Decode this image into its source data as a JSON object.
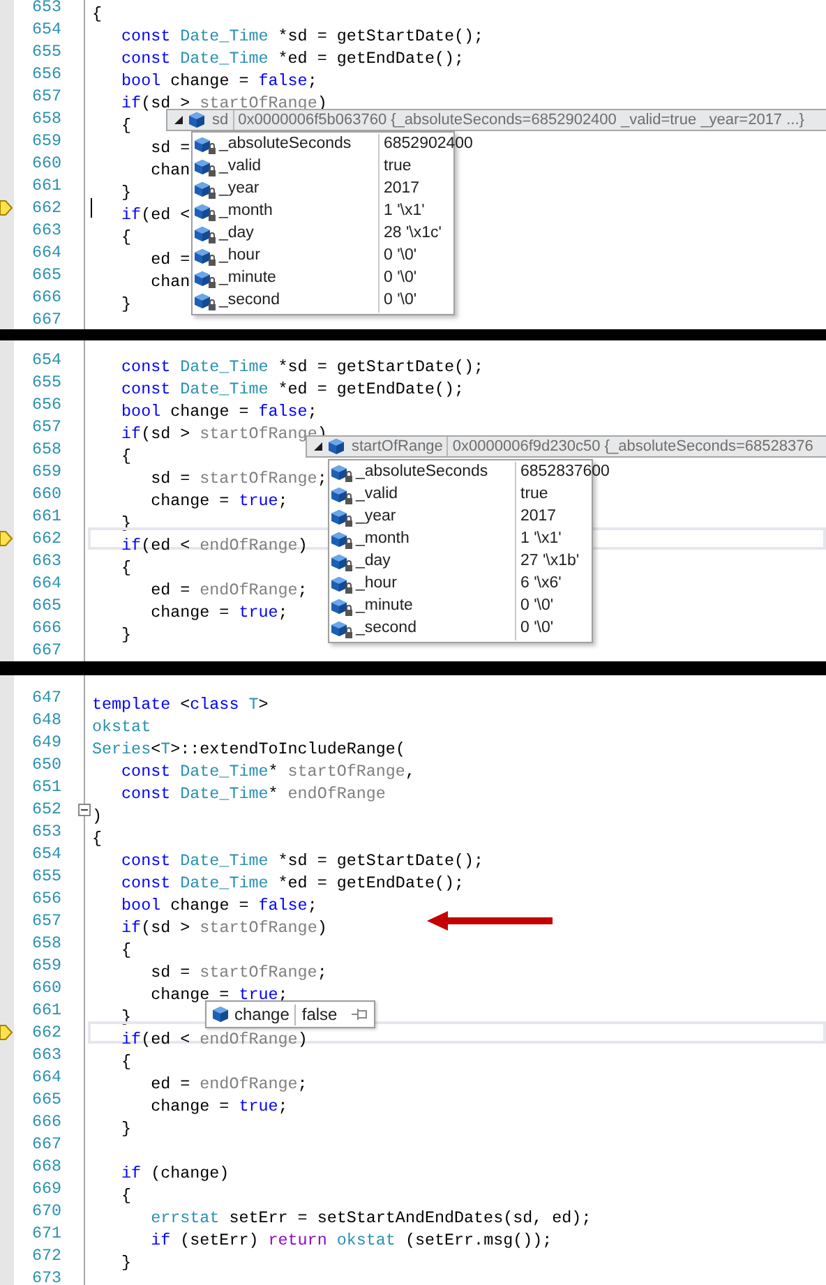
{
  "panels": [
    {
      "caret": true,
      "line_frame": false,
      "arrow": false,
      "lines": [
        {
          "number": "653",
          "current": false,
          "code": [
            {
              "kind": "plain",
              "text": "{"
            }
          ]
        },
        {
          "number": "654",
          "current": false,
          "code": [
            {
              "kind": "keyword",
              "text": "   const "
            },
            {
              "kind": "type",
              "text": "Date_Time"
            },
            {
              "kind": "plain",
              "text": " *sd = getStartDate();"
            }
          ]
        },
        {
          "number": "655",
          "current": false,
          "code": [
            {
              "kind": "keyword",
              "text": "   const "
            },
            {
              "kind": "type",
              "text": "Date_Time"
            },
            {
              "kind": "plain",
              "text": " *ed = getEndDate();"
            }
          ]
        },
        {
          "number": "656",
          "current": false,
          "code": [
            {
              "kind": "keyword",
              "text": "   bool"
            },
            {
              "kind": "plain",
              "text": " change = "
            },
            {
              "kind": "keyword",
              "text": "false"
            },
            {
              "kind": "plain",
              "text": ";"
            }
          ]
        },
        {
          "number": "657",
          "current": false,
          "code": [
            {
              "kind": "keyword",
              "text": "   if"
            },
            {
              "kind": "plain",
              "text": "(sd > "
            },
            {
              "kind": "parameter",
              "text": "startOfRange"
            },
            {
              "kind": "plain",
              "text": ")"
            }
          ]
        },
        {
          "number": "658",
          "current": false,
          "code": [
            {
              "kind": "plain",
              "text": "   {"
            }
          ]
        },
        {
          "number": "659",
          "current": false,
          "code": [
            {
              "kind": "plain",
              "text": "      sd ="
            }
          ]
        },
        {
          "number": "660",
          "current": false,
          "code": [
            {
              "kind": "plain",
              "text": "      chan"
            }
          ]
        },
        {
          "number": "661",
          "current": false,
          "code": [
            {
              "kind": "plain",
              "text": "   }"
            }
          ]
        },
        {
          "number": "662",
          "current": true,
          "code": [
            {
              "kind": "keyword",
              "text": "   if"
            },
            {
              "kind": "plain",
              "text": "(ed <"
            }
          ]
        },
        {
          "number": "663",
          "current": false,
          "code": [
            {
              "kind": "plain",
              "text": "   {"
            }
          ]
        },
        {
          "number": "664",
          "current": false,
          "code": [
            {
              "kind": "plain",
              "text": "      ed ="
            }
          ]
        },
        {
          "number": "665",
          "current": false,
          "code": [
            {
              "kind": "plain",
              "text": "      chan"
            }
          ]
        },
        {
          "number": "666",
          "current": false,
          "code": [
            {
              "kind": "plain",
              "text": "   }"
            }
          ]
        },
        {
          "number": "667",
          "current": false
        }
      ],
      "datatip": {
        "kind": "expandable",
        "name": "sd",
        "summary": "0x0000006f5b063760 {_absoluteSeconds=6852902400 _valid=true _year=2017 ...}",
        "members": [
          {
            "name": "_absoluteSeconds",
            "value": "6852902400"
          },
          {
            "name": "_valid",
            "value": "true"
          },
          {
            "name": "_year",
            "value": "2017"
          },
          {
            "name": "_month",
            "value": "1 '\\x1'"
          },
          {
            "name": "_day",
            "value": "28 '\\x1c'"
          },
          {
            "name": "_hour",
            "value": "0 '\\0'"
          },
          {
            "name": "_minute",
            "value": "0 '\\0'"
          },
          {
            "name": "_second",
            "value": "0 '\\0'"
          }
        ]
      }
    },
    {
      "caret": false,
      "line_frame": true,
      "arrow": false,
      "lines": [
        {
          "number": "654",
          "current": false,
          "code": [
            {
              "kind": "keyword",
              "text": "   const "
            },
            {
              "kind": "type",
              "text": "Date_Time"
            },
            {
              "kind": "plain",
              "text": " *sd = getStartDate();"
            }
          ]
        },
        {
          "number": "655",
          "current": false,
          "code": [
            {
              "kind": "keyword",
              "text": "   const "
            },
            {
              "kind": "type",
              "text": "Date_Time"
            },
            {
              "kind": "plain",
              "text": " *ed = getEndDate();"
            }
          ]
        },
        {
          "number": "656",
          "current": false,
          "code": [
            {
              "kind": "keyword",
              "text": "   bool"
            },
            {
              "kind": "plain",
              "text": " change = "
            },
            {
              "kind": "keyword",
              "text": "false"
            },
            {
              "kind": "plain",
              "text": ";"
            }
          ]
        },
        {
          "number": "657",
          "current": false,
          "code": [
            {
              "kind": "keyword",
              "text": "   if"
            },
            {
              "kind": "plain",
              "text": "(sd > "
            },
            {
              "kind": "parameter",
              "text": "startOfRange"
            },
            {
              "kind": "plain",
              "text": ")"
            }
          ]
        },
        {
          "number": "658",
          "current": false,
          "code": [
            {
              "kind": "plain",
              "text": "   {"
            }
          ]
        },
        {
          "number": "659",
          "current": false,
          "code": [
            {
              "kind": "plain",
              "text": "      sd = "
            },
            {
              "kind": "parameter",
              "text": "startOfRange"
            },
            {
              "kind": "plain",
              "text": ";"
            }
          ]
        },
        {
          "number": "660",
          "current": false,
          "code": [
            {
              "kind": "plain",
              "text": "      change = "
            },
            {
              "kind": "keyword",
              "text": "true"
            },
            {
              "kind": "plain",
              "text": ";"
            }
          ]
        },
        {
          "number": "661",
          "current": false,
          "code": [
            {
              "kind": "plain",
              "text": "   }"
            }
          ]
        },
        {
          "number": "662",
          "current": true,
          "code": [
            {
              "kind": "keyword",
              "text": "   if"
            },
            {
              "kind": "plain",
              "text": "(ed < "
            },
            {
              "kind": "parameter",
              "text": "endOfRange"
            },
            {
              "kind": "plain",
              "text": ")"
            }
          ]
        },
        {
          "number": "663",
          "current": false,
          "code": [
            {
              "kind": "plain",
              "text": "   {"
            }
          ]
        },
        {
          "number": "664",
          "current": false,
          "code": [
            {
              "kind": "plain",
              "text": "      ed = "
            },
            {
              "kind": "parameter",
              "text": "endOfRange"
            },
            {
              "kind": "plain",
              "text": ";"
            }
          ]
        },
        {
          "number": "665",
          "current": false,
          "code": [
            {
              "kind": "plain",
              "text": "      change = "
            },
            {
              "kind": "keyword",
              "text": "true"
            },
            {
              "kind": "plain",
              "text": ";"
            }
          ]
        },
        {
          "number": "666",
          "current": false,
          "code": [
            {
              "kind": "plain",
              "text": "   }"
            }
          ]
        },
        {
          "number": "667",
          "current": false
        }
      ],
      "datatip": {
        "kind": "expandable",
        "name": "startOfRange",
        "summary": "0x0000006f9d230c50 {_absoluteSeconds=68528376",
        "members": [
          {
            "name": "_absoluteSeconds",
            "value": "6852837600"
          },
          {
            "name": "_valid",
            "value": "true"
          },
          {
            "name": "_year",
            "value": "2017"
          },
          {
            "name": "_month",
            "value": "1 '\\x1'"
          },
          {
            "name": "_day",
            "value": "27 '\\x1b'"
          },
          {
            "name": "_hour",
            "value": "6 '\\x6'"
          },
          {
            "name": "_minute",
            "value": "0 '\\0'"
          },
          {
            "name": "_second",
            "value": "0 '\\0'"
          }
        ]
      }
    },
    {
      "caret": false,
      "line_frame": true,
      "arrow": true,
      "lines": [
        {
          "number": "647",
          "current": false,
          "fold": false,
          "code": [
            {
              "kind": "keyword",
              "text": "template"
            },
            {
              "kind": "plain",
              "text": " <"
            },
            {
              "kind": "keyword",
              "text": "class "
            },
            {
              "kind": "type",
              "text": "T"
            },
            {
              "kind": "plain",
              "text": ">"
            }
          ]
        },
        {
          "number": "648",
          "current": false,
          "fold": false,
          "code": [
            {
              "kind": "type",
              "text": "okstat"
            }
          ]
        },
        {
          "number": "649",
          "current": false,
          "fold": false,
          "code": [
            {
              "kind": "type",
              "text": "Series"
            },
            {
              "kind": "plain",
              "text": "<"
            },
            {
              "kind": "type",
              "text": "T"
            },
            {
              "kind": "plain",
              "text": ">::extendToIncludeRange("
            }
          ]
        },
        {
          "number": "650",
          "current": false,
          "fold": false,
          "code": [
            {
              "kind": "keyword",
              "text": "   const "
            },
            {
              "kind": "type",
              "text": "Date_Time"
            },
            {
              "kind": "plain",
              "text": "* "
            },
            {
              "kind": "parameter",
              "text": "startOfRange"
            },
            {
              "kind": "plain",
              "text": ","
            }
          ]
        },
        {
          "number": "651",
          "current": false,
          "fold": false,
          "code": [
            {
              "kind": "keyword",
              "text": "   const "
            },
            {
              "kind": "type",
              "text": "Date_Time"
            },
            {
              "kind": "plain",
              "text": "* "
            },
            {
              "kind": "parameter",
              "text": "endOfRange"
            }
          ]
        },
        {
          "number": "652",
          "current": false,
          "fold": true,
          "code": [
            {
              "kind": "plain",
              "text": ")"
            }
          ]
        },
        {
          "number": "653",
          "current": false,
          "fold": false,
          "code": [
            {
              "kind": "plain",
              "text": "{"
            }
          ]
        },
        {
          "number": "654",
          "current": false,
          "fold": false,
          "code": [
            {
              "kind": "keyword",
              "text": "   const "
            },
            {
              "kind": "type",
              "text": "Date_Time"
            },
            {
              "kind": "plain",
              "text": " *sd = getStartDate();"
            }
          ]
        },
        {
          "number": "655",
          "current": false,
          "fold": false,
          "code": [
            {
              "kind": "keyword",
              "text": "   const "
            },
            {
              "kind": "type",
              "text": "Date_Time"
            },
            {
              "kind": "plain",
              "text": " *ed = getEndDate();"
            }
          ]
        },
        {
          "number": "656",
          "current": false,
          "fold": false,
          "code": [
            {
              "kind": "keyword",
              "text": "   bool"
            },
            {
              "kind": "plain",
              "text": " change = "
            },
            {
              "kind": "keyword",
              "text": "false"
            },
            {
              "kind": "plain",
              "text": ";"
            }
          ]
        },
        {
          "number": "657",
          "current": false,
          "fold": false,
          "code": [
            {
              "kind": "keyword",
              "text": "   if"
            },
            {
              "kind": "plain",
              "text": "(sd > "
            },
            {
              "kind": "parameter",
              "text": "startOfRange"
            },
            {
              "kind": "plain",
              "text": ")"
            }
          ]
        },
        {
          "number": "658",
          "current": false,
          "fold": false,
          "code": [
            {
              "kind": "plain",
              "text": "   {"
            }
          ]
        },
        {
          "number": "659",
          "current": false,
          "fold": false,
          "code": [
            {
              "kind": "plain",
              "text": "      sd = "
            },
            {
              "kind": "parameter",
              "text": "startOfRange"
            },
            {
              "kind": "plain",
              "text": ";"
            }
          ]
        },
        {
          "number": "660",
          "current": false,
          "fold": false,
          "code": [
            {
              "kind": "plain",
              "text": "      change = "
            },
            {
              "kind": "keyword",
              "text": "true"
            },
            {
              "kind": "plain",
              "text": ";"
            }
          ]
        },
        {
          "number": "661",
          "current": false,
          "fold": false,
          "code": [
            {
              "kind": "plain",
              "text": "   }"
            }
          ]
        },
        {
          "number": "662",
          "current": true,
          "fold": false,
          "code": [
            {
              "kind": "keyword",
              "text": "   if"
            },
            {
              "kind": "plain",
              "text": "(ed < "
            },
            {
              "kind": "parameter",
              "text": "endOfRange"
            },
            {
              "kind": "plain",
              "text": ")"
            }
          ]
        },
        {
          "number": "663",
          "current": false,
          "fold": false,
          "code": [
            {
              "kind": "plain",
              "text": "   {"
            }
          ]
        },
        {
          "number": "664",
          "current": false,
          "fold": false,
          "code": [
            {
              "kind": "plain",
              "text": "      ed = "
            },
            {
              "kind": "parameter",
              "text": "endOfRange"
            },
            {
              "kind": "plain",
              "text": ";"
            }
          ]
        },
        {
          "number": "665",
          "current": false,
          "fold": false,
          "code": [
            {
              "kind": "plain",
              "text": "      change = "
            },
            {
              "kind": "keyword",
              "text": "true"
            },
            {
              "kind": "plain",
              "text": ";"
            }
          ]
        },
        {
          "number": "666",
          "current": false,
          "fold": false,
          "code": [
            {
              "kind": "plain",
              "text": "   }"
            }
          ]
        },
        {
          "number": "667",
          "current": false,
          "fold": false
        },
        {
          "number": "668",
          "current": false,
          "fold": false,
          "code": [
            {
              "kind": "keyword",
              "text": "   if"
            },
            {
              "kind": "plain",
              "text": " (change)"
            }
          ]
        },
        {
          "number": "669",
          "current": false,
          "fold": false,
          "code": [
            {
              "kind": "plain",
              "text": "   {"
            }
          ]
        },
        {
          "number": "670",
          "current": false,
          "fold": false,
          "code": [
            {
              "kind": "type",
              "text": "      errstat"
            },
            {
              "kind": "plain",
              "text": " setErr = setStartAndEndDates(sd, ed);"
            }
          ]
        },
        {
          "number": "671",
          "current": false,
          "fold": false,
          "code": [
            {
              "kind": "keyword",
              "text": "      if"
            },
            {
              "kind": "plain",
              "text": " (setErr) "
            },
            {
              "kind": "flow",
              "text": "return "
            },
            {
              "kind": "type",
              "text": "okstat"
            },
            {
              "kind": "plain",
              "text": " (setErr.msg());"
            }
          ]
        },
        {
          "number": "672",
          "current": false,
          "fold": false,
          "code": [
            {
              "kind": "plain",
              "text": "   }"
            }
          ]
        },
        {
          "number": "673",
          "current": false,
          "fold": false
        }
      ],
      "datatip": {
        "kind": "simple",
        "name": "change",
        "summary": "false"
      }
    }
  ]
}
